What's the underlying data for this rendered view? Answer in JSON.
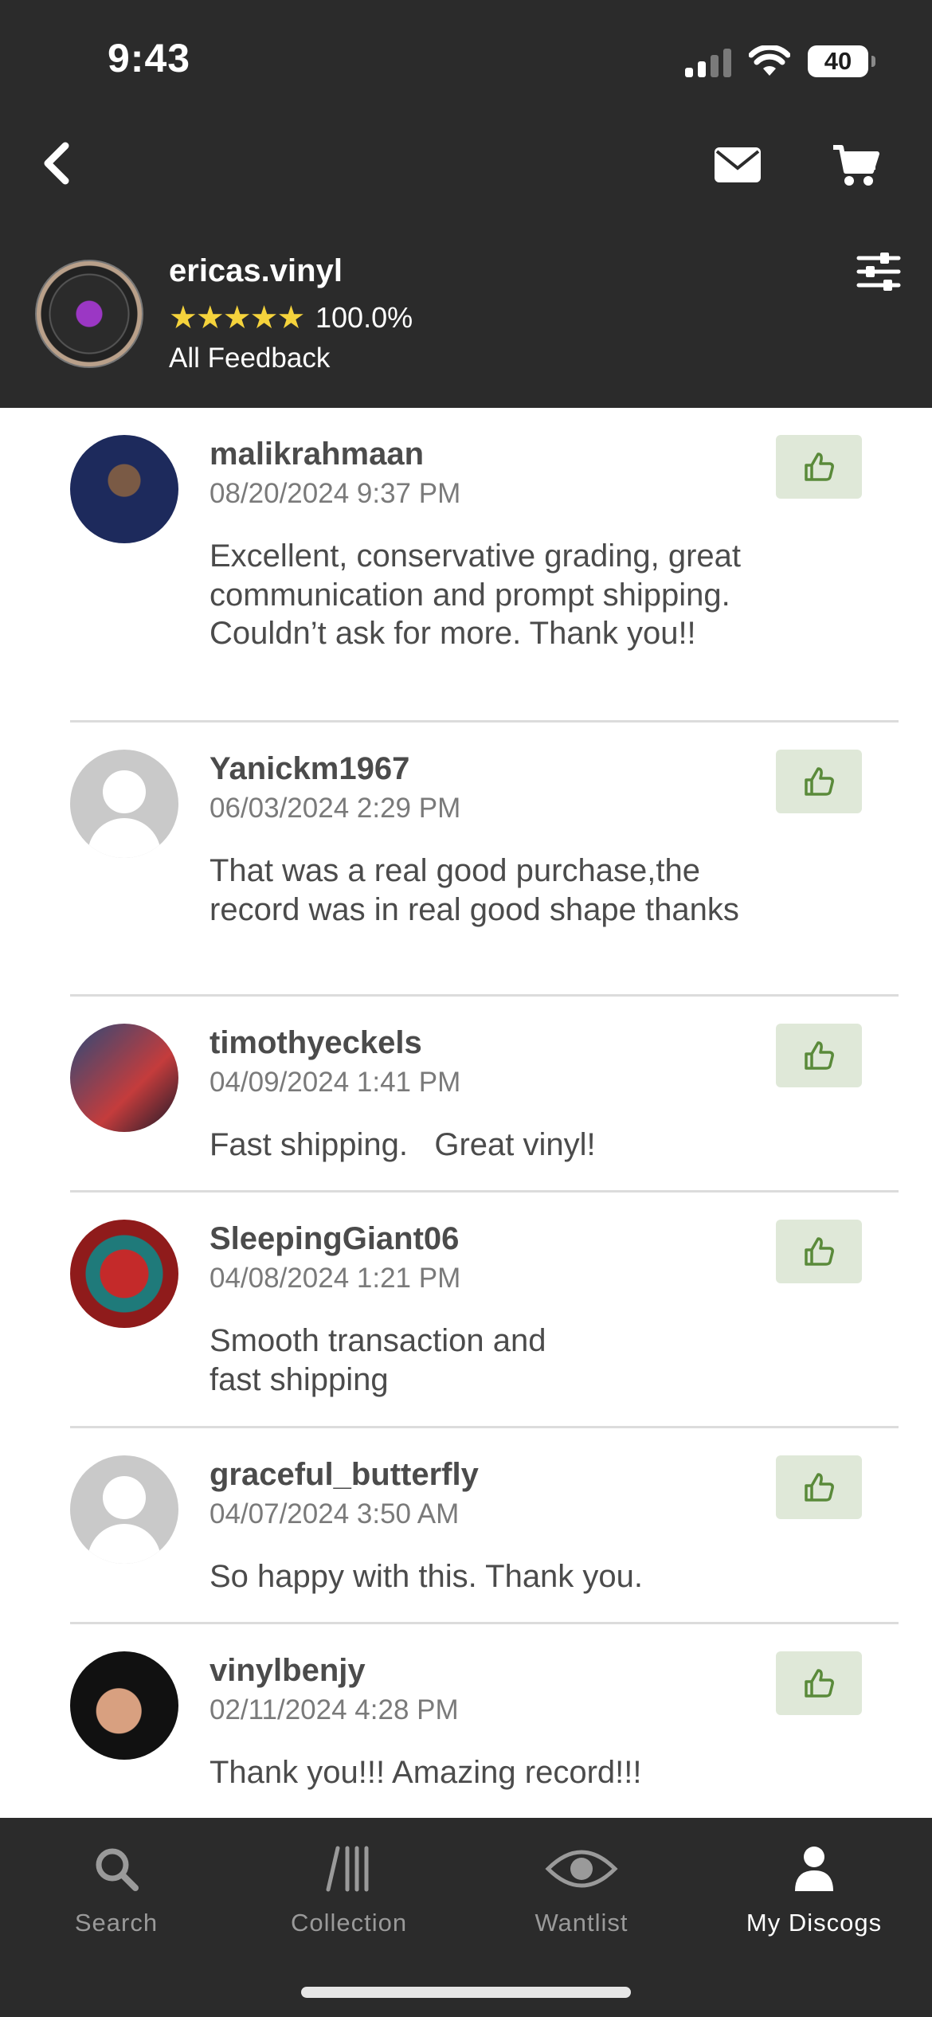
{
  "status_bar": {
    "time": "9:43",
    "battery": "40"
  },
  "header": {
    "back_icon": "chevron-left-icon",
    "mail_icon": "envelope-icon",
    "cart_icon": "shopping-cart-icon",
    "filter_icon": "sliders-icon"
  },
  "seller": {
    "name": "ericas.vinyl",
    "stars": "★★★★★",
    "rating": 5,
    "percent": "100.0%",
    "subtitle": "All Feedback",
    "star_color": "#f5d33c"
  },
  "feedback": [
    {
      "user": "malikrahmaan",
      "date": "08/20/2024 9:37 PM",
      "comment": "Excellent, conservative grading, great communication and prompt shipping. Couldn’t ask for more. Thank you!!",
      "avatar": "photo"
    },
    {
      "user": "Yanickm1967",
      "date": "06/03/2024 2:29 PM",
      "comment": "That was a real good purchase,the record was in real good shape thanks",
      "avatar": "generic"
    },
    {
      "user": "timothyeckels",
      "date": "04/09/2024 1:41 PM",
      "comment": "Fast shipping.   Great vinyl!",
      "avatar": "photo"
    },
    {
      "user": "SleepingGiant06",
      "date": "04/08/2024 1:21 PM",
      "comment": "Smooth transaction and fast shipping",
      "avatar": "photo"
    },
    {
      "user": "graceful_butterfly",
      "date": "04/07/2024 3:50 AM",
      "comment": "So happy with this. Thank you.",
      "avatar": "generic"
    },
    {
      "user": "vinylbenjy",
      "date": "02/11/2024 4:28 PM",
      "comment": "Thank you!!! Amazing record!!!",
      "avatar": "photo"
    }
  ],
  "feedback_type_icon": "thumbs-up-icon",
  "colors": {
    "header_bg": "#2b2b2b",
    "thumb_bg": "#dfe8d8",
    "thumb_icon": "#5a8a3a",
    "divider": "#dcdcdc"
  },
  "tabs": [
    {
      "label": "Search",
      "icon": "search-icon",
      "active": false
    },
    {
      "label": "Collection",
      "icon": "collection-icon",
      "active": false
    },
    {
      "label": "Wantlist",
      "icon": "eye-icon",
      "active": false
    },
    {
      "label": "My Discogs",
      "icon": "user-icon",
      "active": true
    }
  ]
}
